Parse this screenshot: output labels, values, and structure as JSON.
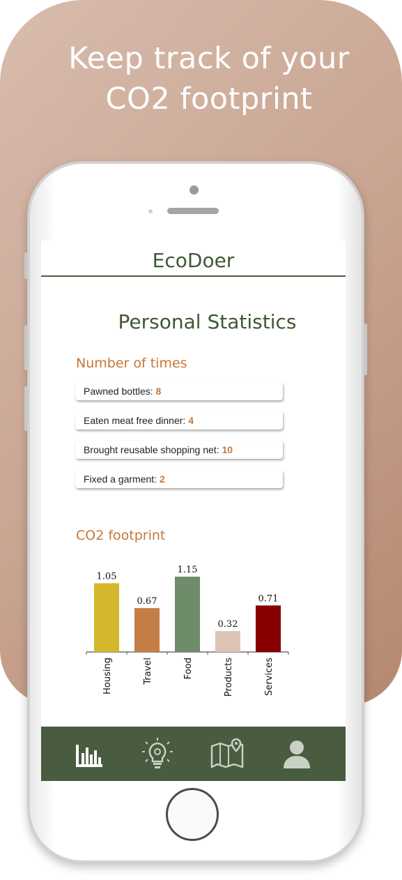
{
  "promo": {
    "headline_line1": "Keep track of your",
    "headline_line2": "CO2 footprint"
  },
  "app": {
    "title": "EcoDoer"
  },
  "page": {
    "title": "Personal Statistics"
  },
  "counts_section": {
    "title": "Number of times",
    "items": [
      {
        "label": "Pawned bottles: ",
        "value": "8"
      },
      {
        "label": "Eaten meat free dinner: ",
        "value": "4"
      },
      {
        "label": "Brought reusable shopping net: ",
        "value": "10"
      },
      {
        "label": "Fixed a garment: ",
        "value": "2"
      }
    ]
  },
  "footprint_section": {
    "title": "CO2 footprint"
  },
  "chart_data": {
    "type": "bar",
    "title": "",
    "xlabel": "",
    "ylabel": "",
    "categories": [
      "Housing",
      "Travel",
      "Food",
      "Products",
      "Services"
    ],
    "values": [
      1.05,
      0.67,
      1.15,
      0.32,
      0.71
    ],
    "value_labels": [
      "1.05",
      "0.67",
      "1.15",
      "0.32",
      "0.71"
    ],
    "colors": [
      "#d4b72c",
      "#c47e45",
      "#6e8c69",
      "#dcc4b6",
      "#880000"
    ],
    "ylim": [
      0,
      1.15
    ],
    "grid": false
  },
  "navbar": {
    "items": [
      {
        "icon": "bar-chart-icon",
        "selected": true
      },
      {
        "icon": "lightbulb-icon",
        "selected": false
      },
      {
        "icon": "map-icon",
        "selected": false
      },
      {
        "icon": "user-icon",
        "selected": false
      }
    ]
  },
  "colors": {
    "brand_green": "#4a5c3f",
    "accent_orange": "#c4773a",
    "icon_light": "#c9d0c6"
  }
}
